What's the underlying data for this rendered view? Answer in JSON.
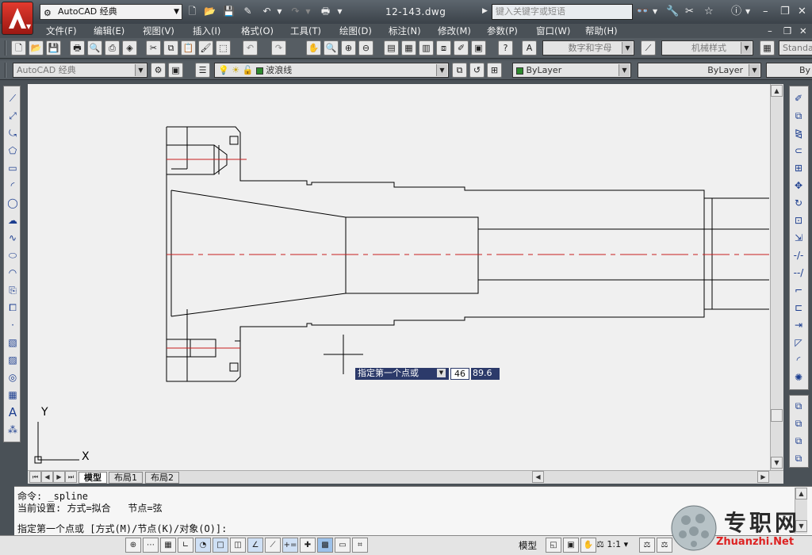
{
  "title_bar": {
    "workspace": "AutoCAD 经典",
    "document_title": "12-143.dwg",
    "search_placeholder": "键入关键字或短语"
  },
  "menus": [
    "文件(F)",
    "编辑(E)",
    "视图(V)",
    "插入(I)",
    "格式(O)",
    "工具(T)",
    "绘图(D)",
    "标注(N)",
    "修改(M)",
    "参数(P)",
    "窗口(W)",
    "帮助(H)"
  ],
  "toolbar1": {
    "text_style": "数字和字母",
    "dim_style": "机械样式",
    "table_style": "Standa"
  },
  "toolbar2": {
    "workspace": "AutoCAD 经典",
    "layer": "波浪线",
    "color": "ByLayer",
    "linetype": "ByLayer",
    "lineweight": "By"
  },
  "canvas": {
    "ucs_y": "Y",
    "ucs_x": "X",
    "tooltip_prompt": "指定第一个点或",
    "tooltip_x": "46",
    "tooltip_y": "89.6"
  },
  "layout_tabs": [
    "模型",
    "布局1",
    "布局2"
  ],
  "command_lines": [
    "命令: _spline",
    "当前设置: 方式=拟合   节点=弦",
    "指定第一个点或 [方式(M)/节点(K)/对象(O)]:"
  ],
  "status": {
    "model_label": "模型",
    "scale": "1:1"
  },
  "watermark": {
    "text": "专职网",
    "url": "Zhuanzhi.Net"
  },
  "colors": {
    "center_line": "#c81e1e",
    "drawing_line": "#000000",
    "canvas_bg": "#f0f0f0",
    "app_red": "#d92b22"
  }
}
